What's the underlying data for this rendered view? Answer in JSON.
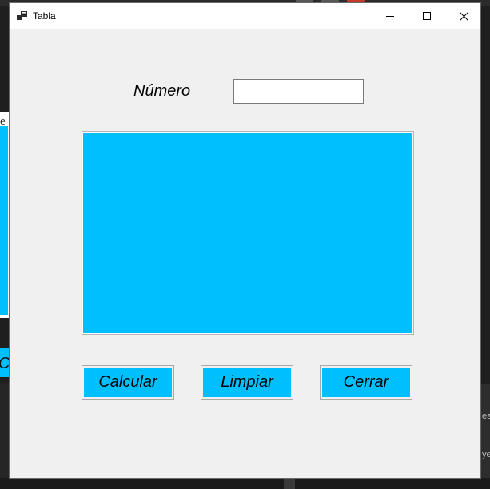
{
  "window": {
    "title": "Tabla",
    "icon": "app-window-icon",
    "controls": [
      "minimize-icon",
      "maximize-icon",
      "close-icon"
    ]
  },
  "form": {
    "numero_label": "Número",
    "numero_value": "",
    "output_text": ""
  },
  "buttons": {
    "calcular": "Calcular",
    "limpiar": "Limpiar",
    "cerrar": "Cerrar"
  },
  "colors": {
    "accent": "#00bfff",
    "form_background": "#f0f0f0",
    "titlebar": "#ffffff"
  }
}
